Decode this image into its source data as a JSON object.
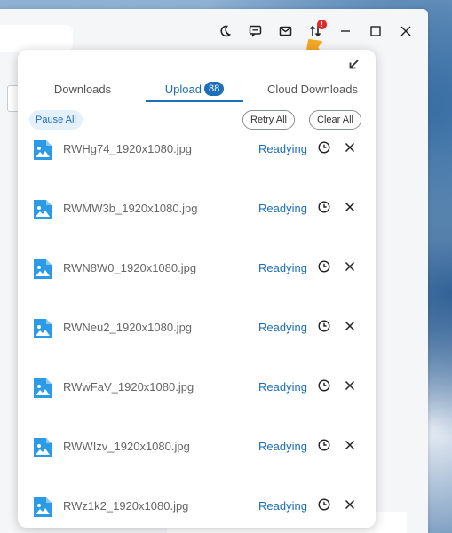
{
  "titlebar": {
    "icons": [
      "moon-icon",
      "chat-icon",
      "mail-icon",
      "transfer-icon",
      "minimize-icon",
      "maximize-icon",
      "close-icon"
    ],
    "transfer_badge": "!"
  },
  "popup": {
    "tabs": [
      {
        "label": "Downloads"
      },
      {
        "label": "Upload",
        "count": "88"
      },
      {
        "label": "Cloud Downloads"
      }
    ],
    "active_tab": "Upload",
    "actions": {
      "pause_all": "Pause All",
      "retry_all": "Retry All",
      "clear_all": "Clear All"
    },
    "files": [
      {
        "name": "RWHg74_1920x1080.jpg",
        "status": "Readying"
      },
      {
        "name": "RWMW3b_1920x1080.jpg",
        "status": "Readying"
      },
      {
        "name": "RWN8W0_1920x1080.jpg",
        "status": "Readying"
      },
      {
        "name": "RWNeu2_1920x1080.jpg",
        "status": "Readying"
      },
      {
        "name": "RWwFaV_1920x1080.jpg",
        "status": "Readying"
      },
      {
        "name": "RWWIzv_1920x1080.jpg",
        "status": "Readying"
      },
      {
        "name": "RWz1k2_1920x1080.jpg",
        "status": "Readying"
      }
    ]
  },
  "colors": {
    "accent": "#1d6fb8",
    "file_icon": "#2b9be8",
    "badge_red": "#e02a2a",
    "arrow_orange": "#f5a623"
  }
}
